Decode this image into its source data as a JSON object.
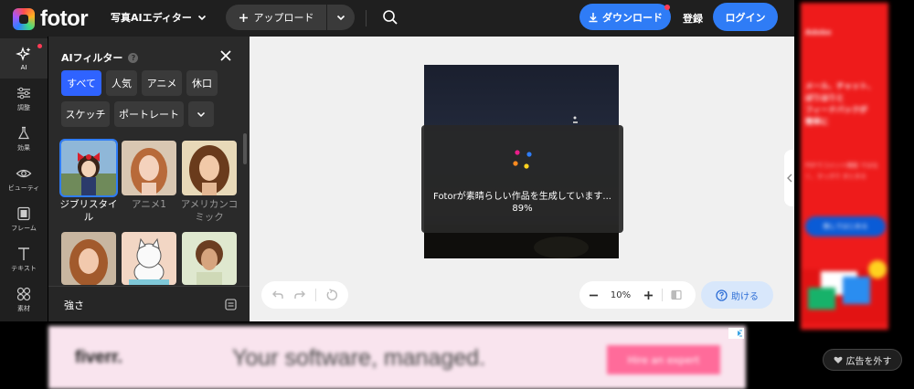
{
  "header": {
    "logo_text": "fotor",
    "editor_switch": "写真AIエディター",
    "upload_label": "アップロード",
    "download_label": "ダウンロード",
    "register_label": "登録",
    "login_label": "ログイン"
  },
  "rail": {
    "items": [
      {
        "label": "AI",
        "icon": "sparkle-icon"
      },
      {
        "label": "調整",
        "icon": "sliders-icon"
      },
      {
        "label": "効果",
        "icon": "flask-icon"
      },
      {
        "label": "ビューティ",
        "icon": "eye-icon"
      },
      {
        "label": "フレーム",
        "icon": "frame-icon"
      },
      {
        "label": "テキスト",
        "icon": "text-icon"
      },
      {
        "label": "素材",
        "icon": "elements-icon"
      }
    ]
  },
  "panel": {
    "title": "AIフィルター",
    "help_mark": "?",
    "chips_row1": [
      "すべて",
      "人気",
      "アニメ",
      "休口"
    ],
    "chips_row2": [
      "スケッチ",
      "ポートレート"
    ],
    "filters": [
      {
        "label": "ジブリスタイル",
        "selected": true
      },
      {
        "label": "アニメ1",
        "selected": false
      },
      {
        "label": "アメリカンコミック",
        "selected": false
      }
    ],
    "strength_label": "強さ"
  },
  "canvas": {
    "progress_message": "Fotorが素晴らしい作品を生成しています...",
    "progress_percent": "89%",
    "progress_value": 0.89,
    "zoom_minus": "−",
    "zoom_value": "10%",
    "zoom_plus": "+",
    "help_label": "助ける"
  },
  "ads": {
    "right": {
      "brand": "Adobe",
      "lines": [
        "メール、チャット、",
        "ぼりほりと",
        "フィードバックが",
        "簡単に"
      ],
      "sub": "PDFでコメント機能 ではなく、すっきり まとまる",
      "cta": "無しではじめる"
    },
    "bottom": {
      "brand": "fiverr.",
      "headline": "Your software, managed.",
      "cta": "Hire an expert"
    },
    "remove_ads_label": "広告を外す"
  },
  "colors": {
    "accent": "#2f7cf6",
    "chip_active": "#2f63ff",
    "notify_dot": "#ff3b55"
  }
}
